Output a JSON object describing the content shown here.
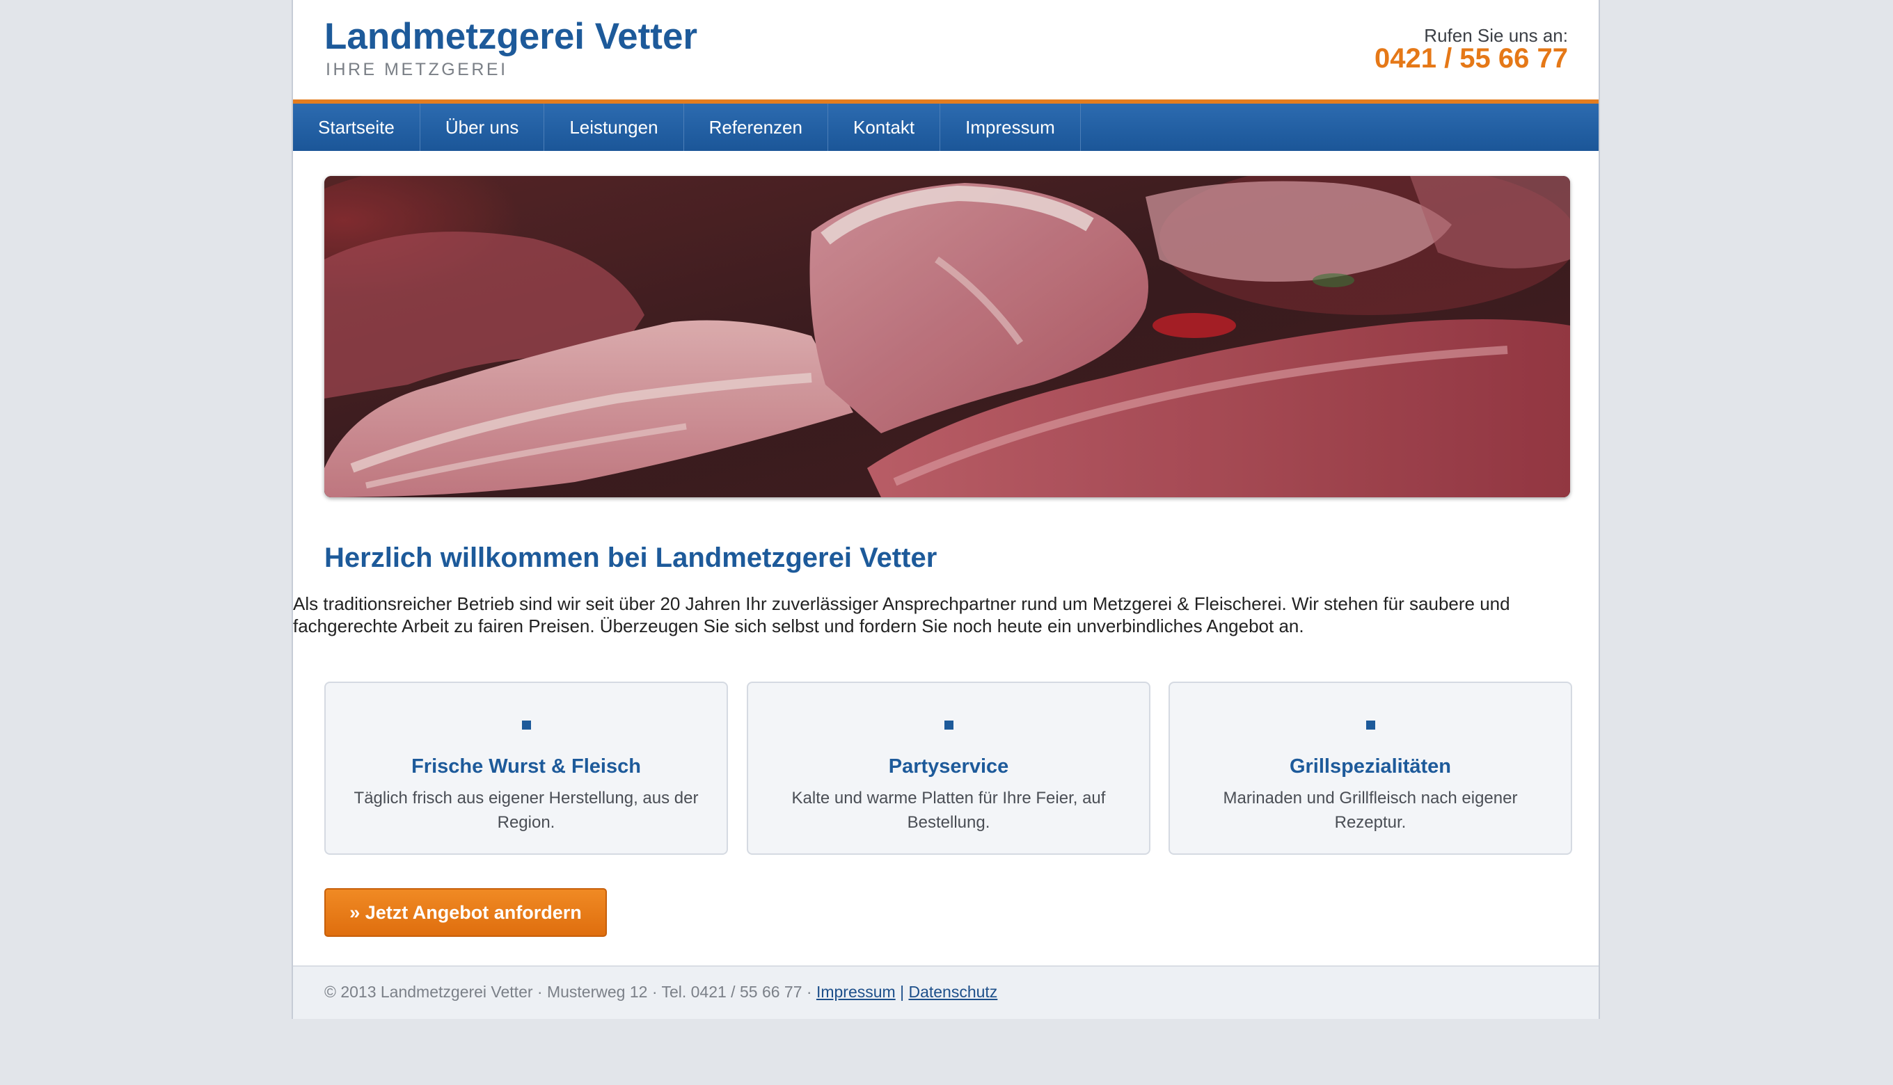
{
  "header": {
    "site_title": "Landmetzgerei Vetter",
    "tagline": "IHRE METZGEREI",
    "call_label": "Rufen Sie uns an:",
    "phone": "0421 / 55 66 77"
  },
  "nav": {
    "items": [
      {
        "label": "Startseite"
      },
      {
        "label": "Über uns"
      },
      {
        "label": "Leistungen"
      },
      {
        "label": "Referenzen"
      },
      {
        "label": "Kontakt"
      },
      {
        "label": "Impressum"
      }
    ]
  },
  "main": {
    "heading": "Herzlich willkommen bei Landmetzgerei Vetter",
    "intro": "Als traditionsreicher Betrieb sind wir seit über 20 Jahren Ihr zuverlässiger Ansprechpartner rund um Metzgerei & Fleischerei. Wir stehen für saubere und fachgerechte Arbeit zu fairen Preisen. Überzeugen Sie sich selbst und fordern Sie noch heute ein unverbindliches Angebot an.",
    "cards": [
      {
        "title": "Frische Wurst & Fleisch",
        "text": "Täglich frisch aus eigener Herstellung, aus der Region."
      },
      {
        "title": "Partyservice",
        "text": "Kalte und warme Platten für Ihre Feier, auf Bestellung."
      },
      {
        "title": "Grillspezialitäten",
        "text": "Marinaden und Grillfleisch nach eigener Rezeptur."
      }
    ],
    "cta_label": "» Jetzt Angebot anfordern"
  },
  "footer": {
    "text": "© 2013 Landmetzgerei Vetter · Musterweg 12 · Tel. 0421 / 55 66 77 ·",
    "impressum_link": "Impressum",
    "separator": "|",
    "datenschutz_link": "Datenschutz"
  },
  "colors": {
    "brand_blue": "#1d5a9a",
    "accent_orange": "#e57817",
    "page_bg": "#e2e5ea"
  }
}
